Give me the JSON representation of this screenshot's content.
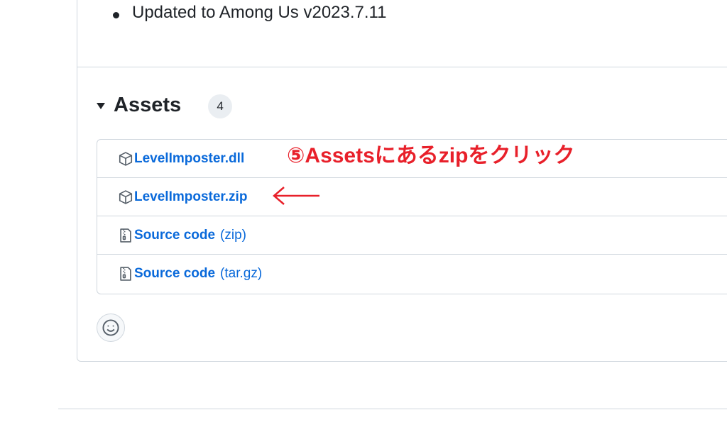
{
  "release": {
    "notes": [
      "Updated to Among Us v2023.7.11"
    ]
  },
  "assets": {
    "title": "Assets",
    "count": "4",
    "items": [
      {
        "name": "LevelImposter.dll",
        "suffix": "",
        "icon": "package-icon"
      },
      {
        "name": "LevelImposter.zip",
        "suffix": "",
        "icon": "package-icon"
      },
      {
        "name": "Source code",
        "suffix": "(zip)",
        "icon": "file-zip-icon"
      },
      {
        "name": "Source code",
        "suffix": "(tar.gz)",
        "icon": "file-zip-icon"
      }
    ]
  },
  "annotation": {
    "text": "⑤Assetsにあるzipをクリック",
    "color": "#e8202a"
  },
  "colors": {
    "link": "#0969da",
    "border": "#d0d7de",
    "text": "#1f2328"
  },
  "reaction": {
    "icon": "smiley-icon"
  }
}
